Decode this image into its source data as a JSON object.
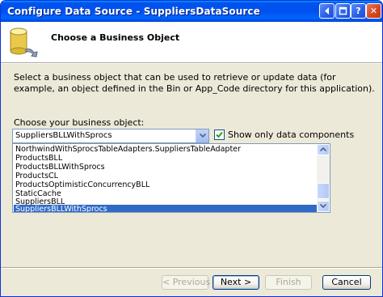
{
  "window": {
    "title": "Configure Data Source - SuppliersDataSource"
  },
  "titlebar_buttons": [
    {
      "name": "back-icon"
    },
    {
      "name": "maximize-icon"
    },
    {
      "name": "help-icon",
      "glyph": "?"
    },
    {
      "name": "close-icon",
      "glyph": "✕"
    }
  ],
  "header": {
    "icon": "database-icon",
    "title": "Choose a Business Object"
  },
  "description": "Select a business object that can be used to retrieve or update data (for example, an object defined in the Bin or App_Code directory for this application).",
  "business_object": {
    "label": "Choose your business object:",
    "selected": "SuppliersBLLWithSprocs"
  },
  "show_only": {
    "label": "Show only data components",
    "checked": true
  },
  "list": {
    "items": [
      "NorthwindWithSprocsTableAdapters.SuppliersTableAdapter",
      "ProductsBLL",
      "ProductsBLLWithSprocs",
      "ProductsCL",
      "ProductsOptimisticConcurrencyBLL",
      "StaticCache",
      "SuppliersBLL",
      "SuppliersBLLWithSprocs"
    ],
    "selected_index": 7
  },
  "buttons": {
    "previous": "< Previous",
    "next": "Next >",
    "finish": "Finish",
    "cancel": "Cancel"
  },
  "colors": {
    "titlebar": "#0053ee",
    "selection": "#316ac5",
    "dialog_bg": "#ece9d8"
  }
}
